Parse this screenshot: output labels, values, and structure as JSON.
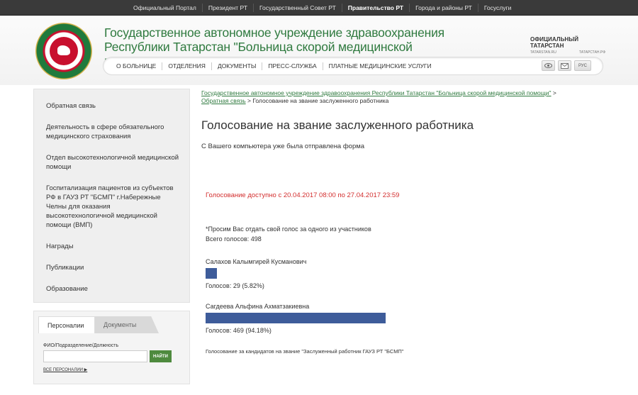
{
  "topbar": {
    "items": [
      "Официальный Портал",
      "Президент РТ",
      "Государственный Совет РТ",
      "Правительство РТ",
      "Города и районы РТ",
      "Госуслуги"
    ],
    "active_index": 3
  },
  "header": {
    "title": "Государственное автономное учреждение здравоохранения Республики Татарстан \"Больница скорой медицинской помощи\"",
    "partner_logo": {
      "title": "ОФИЦИАЛЬНЫЙ ТАТАРСТАН",
      "url_left": "TATARSTAN.RU",
      "url_right": "ТАТАРСТАН.РФ"
    }
  },
  "nav": {
    "items": [
      "О БОЛЬНИЦЕ",
      "ОТДЕЛЕНИЯ",
      "ДОКУМЕНТЫ",
      "ПРЕСС-СЛУЖБА",
      "ПЛАТНЫЕ МЕДИЦИНСКИЕ УСЛУГИ"
    ],
    "lang_label": "РУС",
    "icons": [
      "eye-icon",
      "mail-icon",
      "language-icon"
    ]
  },
  "sidebar": {
    "items": [
      "Обратная связь",
      "Деятельность в сфере обязательного медицинского страхования",
      "Отдел высокотехнологичной медицинской помощи",
      "Госпитализация пациентов из субъектов РФ в ГАУЗ РТ \"БСМП\" г.Набережные Челны для оказания высокотехнологичной медицинской помощи (ВМП)",
      "Награды",
      "Публикации",
      "Образование"
    ]
  },
  "search": {
    "tab_active": "Персоналии",
    "tab_inactive": "Документы",
    "label": "ФИО/Подразделение/Должность",
    "value": "",
    "button": "НАЙТИ",
    "all_link": "ВСЕ ПЕРСОНАЛИИ",
    "all_link_arrow": "▶"
  },
  "content": {
    "breadcrumb": {
      "link1": "Государственное автономное учреждение здравоохранения Республики Татарстан \"Больница скорой медицинской помощи\"",
      "sep": " > ",
      "link2": "Обратная связь",
      "current": "Голосование на звание заслуженного работника"
    },
    "title": "Голосование на звание заслуженного работника",
    "notice": "С Вашего компьютера уже была отправлена форма",
    "availability": "Голосование доступно с 20.04.2017 08:00 по 27.04.2017 23:59",
    "ask": "*Просим Вас отдать свой голос за одного из участников",
    "total": "Всего голосов: 498",
    "candidates": [
      {
        "name": "Салахов Калымгирей Кусманович",
        "votes_text": "Голосов: 29 (5.82%)",
        "share": 0.0582
      },
      {
        "name": "Сагдеева Альфина Ахматзакиевна",
        "votes_text": "Голосов: 469 (94.18%)",
        "share": 0.9418
      }
    ],
    "bar_color": "#3e5c9a",
    "footnote": "Голосование за кандидатов на звание \"Заслуженный работник ГАУЗ РТ \"БСМП\""
  }
}
